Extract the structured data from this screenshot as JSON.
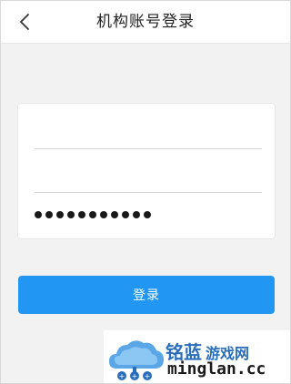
{
  "header": {
    "title": "机构账号登录",
    "back_icon": "chevron-left-icon"
  },
  "form": {
    "account_value": "",
    "account_placeholder": "",
    "second_value": "",
    "second_placeholder": "",
    "password_masked_length": 11
  },
  "actions": {
    "login_label": "登录",
    "button_color": "#2196f3"
  },
  "watermark": {
    "cn_primary": "铭蓝",
    "cn_secondary": "游戏网",
    "en": "minglan.cc",
    "logo_icon": "cloud-logo-icon"
  }
}
